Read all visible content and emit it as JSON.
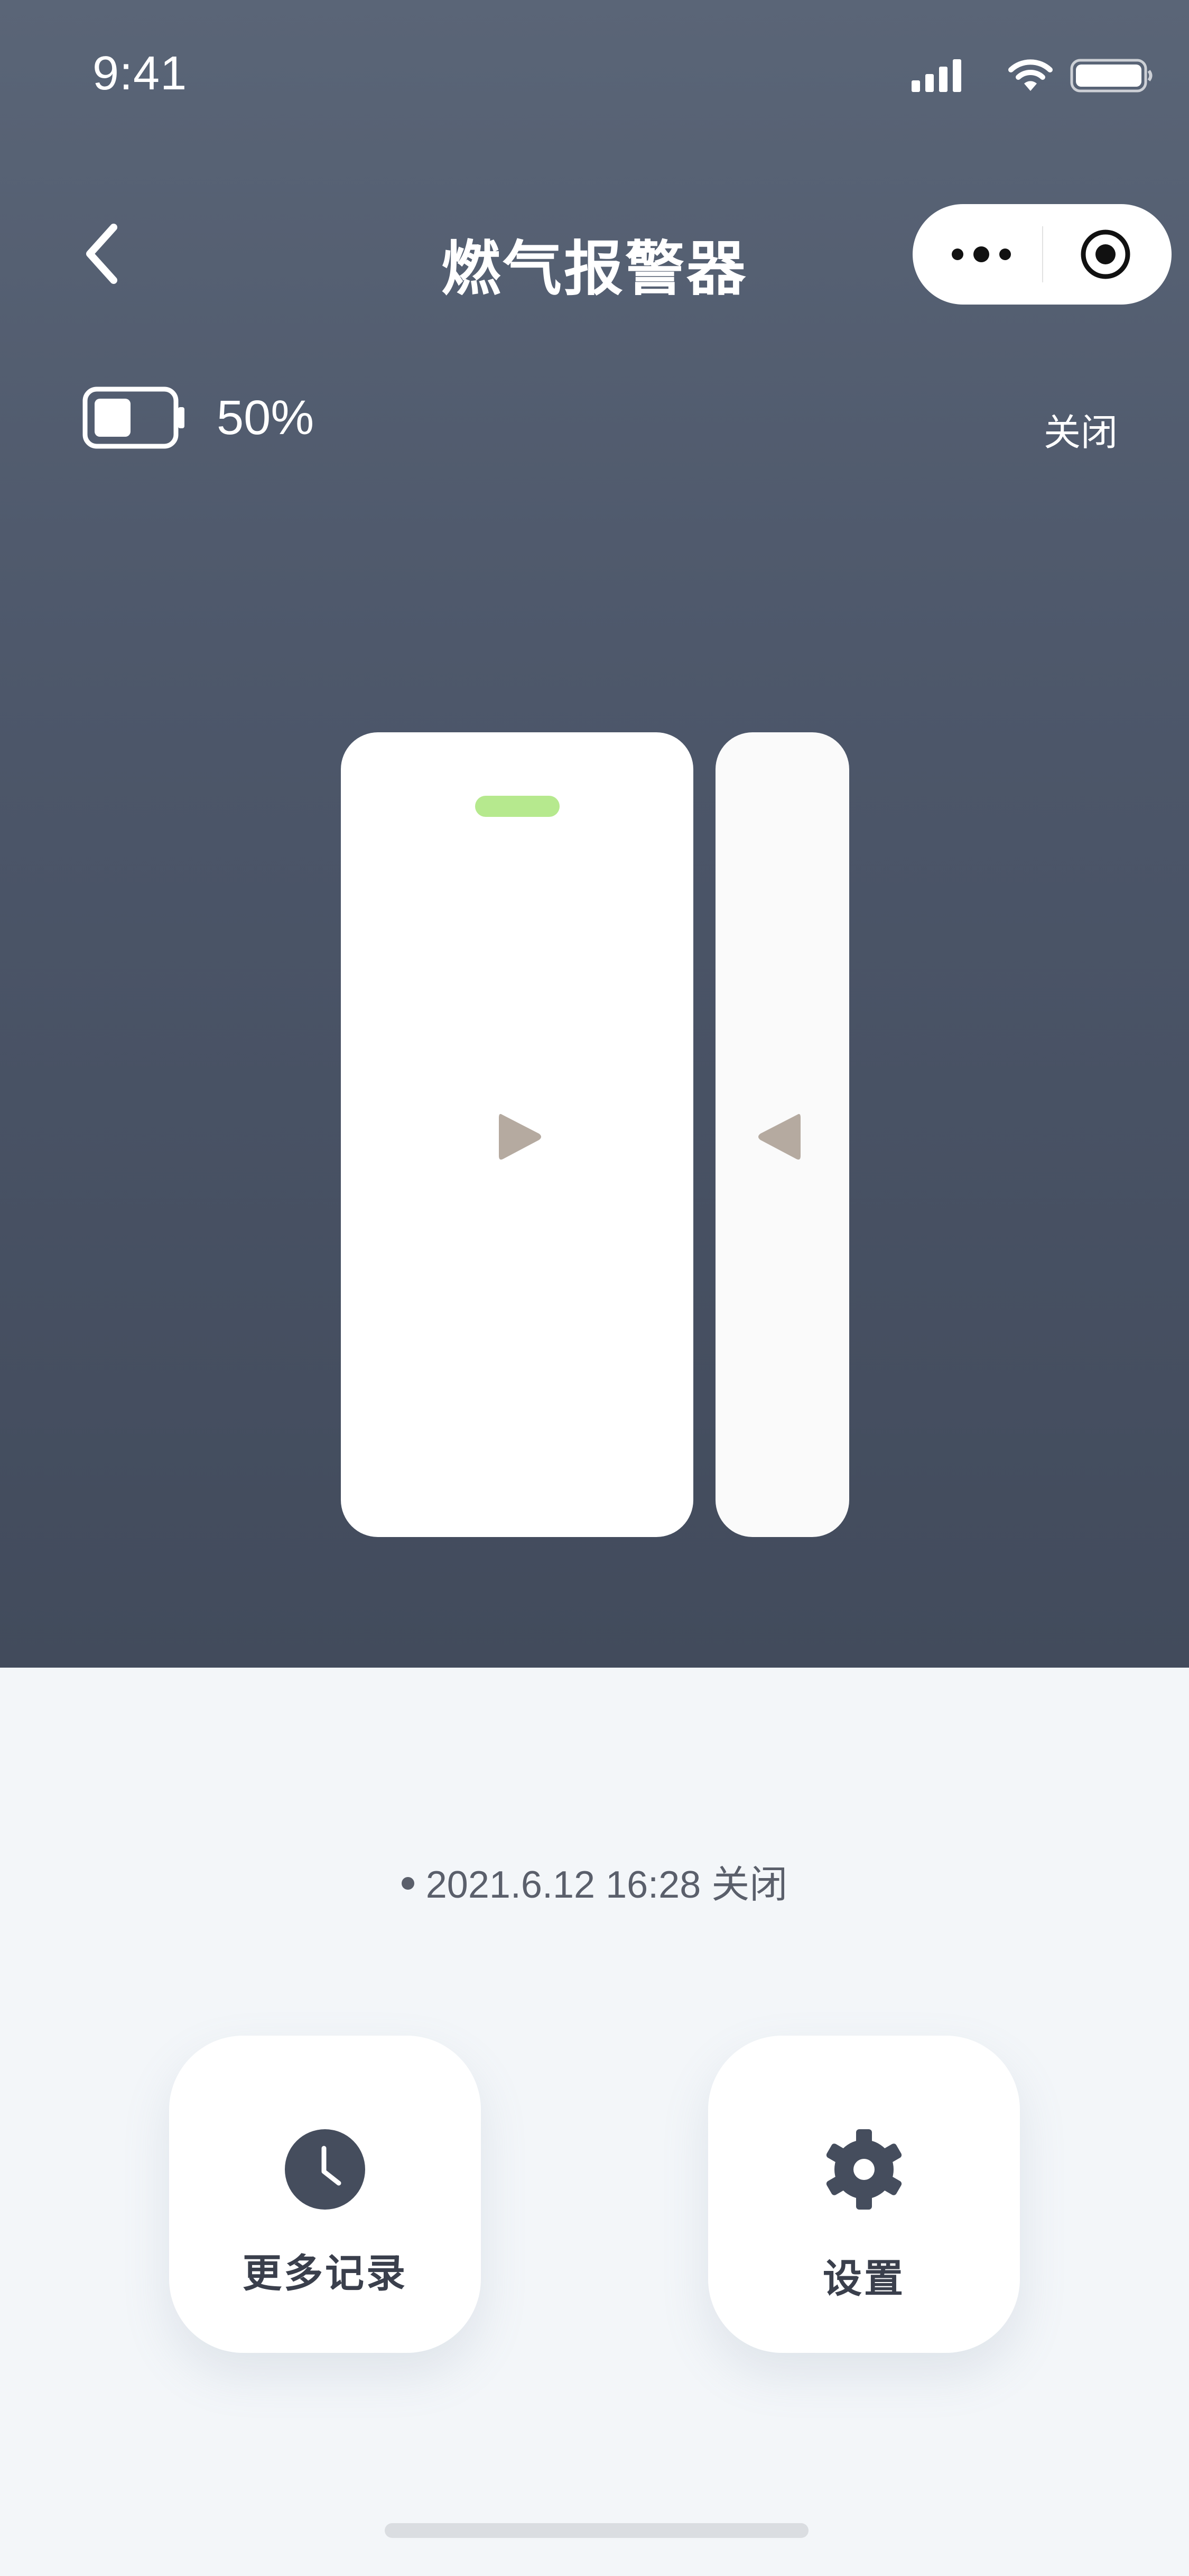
{
  "status_bar": {
    "time": "9:41",
    "icons": [
      "signal-icon",
      "wifi-icon",
      "battery-icon"
    ]
  },
  "nav": {
    "title": "燃气报警器",
    "back_icon": "chevron-left-icon",
    "capsule_icons": [
      "more-dots-icon",
      "target-icon"
    ]
  },
  "device_status": {
    "battery_level": "50%",
    "battery_fill_fraction": 0.5,
    "state": "关闭"
  },
  "sensor": {
    "led_color": "#b6e98e",
    "arrow_color": "#b5aaa0"
  },
  "record": {
    "text": "2021.6.12 16:28 关闭"
  },
  "actions": [
    {
      "label": "更多记录",
      "icon": "clock-icon"
    },
    {
      "label": "设置",
      "icon": "gear-icon"
    }
  ],
  "colors": {
    "hero_top": "#5a6577",
    "hero_bottom": "#424b5c",
    "page_bg": "#f3f6f9",
    "icon_dark": "#454d5d"
  }
}
